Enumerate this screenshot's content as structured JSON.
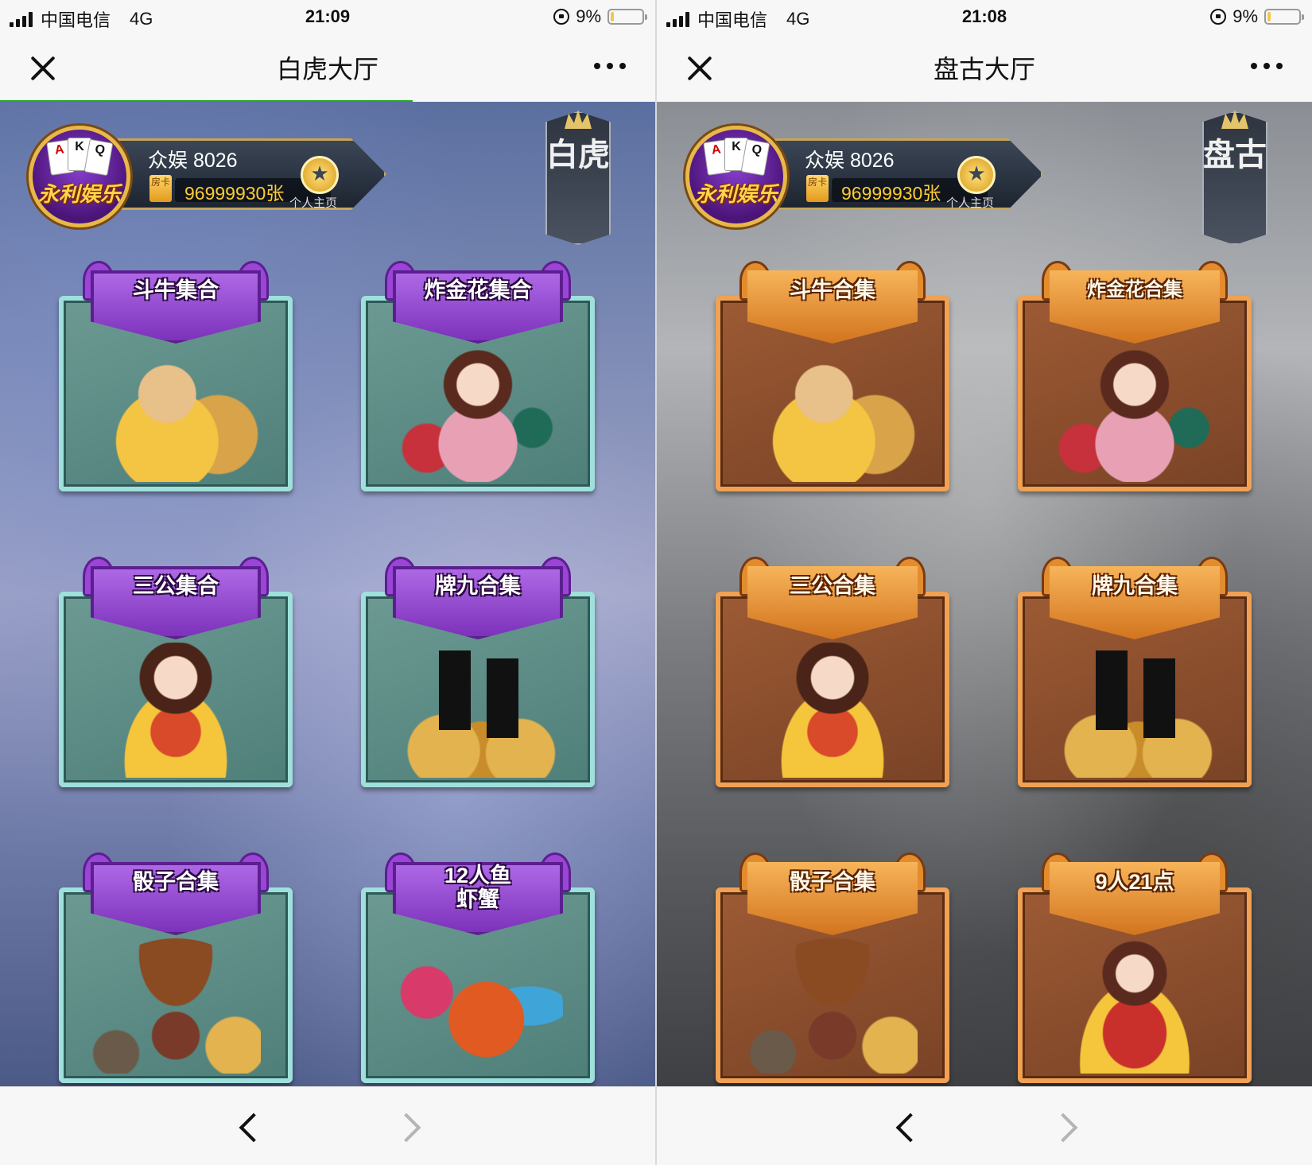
{
  "screens": [
    {
      "theme": "tiger",
      "status": {
        "carrier": "中国电信",
        "network": "4G",
        "time": "21:09",
        "battery": "9%",
        "battery_level": 0.09
      },
      "nav": {
        "title": "白虎大厅"
      },
      "loading_progress": 0.63,
      "profile": {
        "logo_cards": [
          "A",
          "K",
          "Q"
        ],
        "logo_text": "永利娱乐",
        "player_name": "众娱 8026",
        "card_badge": "房卡",
        "card_count": "96999930张",
        "homepage_label": "个人主页"
      },
      "hall_banner": "白虎",
      "games": [
        {
          "label": "斗牛集合",
          "art": "bull-icon"
        },
        {
          "label": "炸金花集合",
          "art": "girl-icon"
        },
        {
          "label": "三公集合",
          "art": "girl-icon"
        },
        {
          "label": "牌九合集",
          "art": "domino-icon"
        },
        {
          "label": "骰子合集",
          "art": "cowgirl-icon"
        },
        {
          "label": "12人鱼虾蟹",
          "art": "crab-icon"
        }
      ]
    },
    {
      "theme": "pangu",
      "status": {
        "carrier": "中国电信",
        "network": "4G",
        "time": "21:08",
        "battery": "9%",
        "battery_level": 0.09
      },
      "nav": {
        "title": "盘古大厅"
      },
      "profile": {
        "logo_cards": [
          "A",
          "K",
          "Q"
        ],
        "logo_text": "永利娱乐",
        "player_name": "众娱 8026",
        "card_badge": "房卡",
        "card_count": "96999930张",
        "homepage_label": "个人主页"
      },
      "hall_banner": "盘古",
      "games": [
        {
          "label": "斗牛合集",
          "art": "bull-icon"
        },
        {
          "label": "炸金花合集",
          "art": "girl-icon"
        },
        {
          "label": "三公合集",
          "art": "girl-icon"
        },
        {
          "label": "牌九合集",
          "art": "domino-icon"
        },
        {
          "label": "骰子合集",
          "art": "cowgirl-icon"
        },
        {
          "label": "9人21点",
          "art": "qipao-girl-icon"
        }
      ]
    }
  ],
  "colors": {
    "progress": "#1aad19",
    "tiger_frame": "#9fe0dc",
    "pangu_frame": "#f0a154",
    "tiger_label": "#9a45d6",
    "pangu_label": "#e38c2e"
  }
}
